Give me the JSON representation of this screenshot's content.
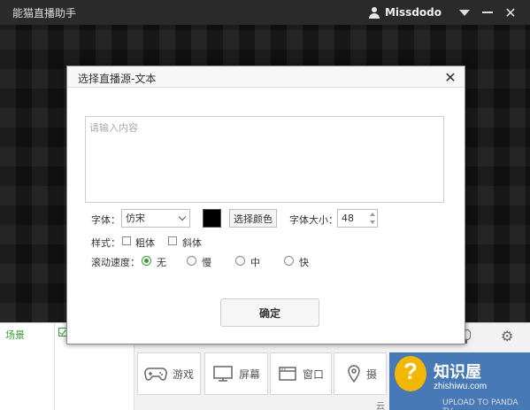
{
  "app": {
    "title": "能猫直播助手",
    "username": "Missdodo"
  },
  "dialog": {
    "title": "选择直播源-文本",
    "content_placeholder": "请输入内容",
    "font_label": "字体：",
    "font_value": "仿宋",
    "pick_color_label": "选择颜色",
    "font_color": "#000000",
    "font_size_label": "字体大小：",
    "font_size_value": "48",
    "style_label": "样式：",
    "bold_label": "粗体",
    "italic_label": "斜体",
    "bold_checked": false,
    "italic_checked": false,
    "speed_label": "滚动速度：",
    "speed_options": [
      "无",
      "慢",
      "中",
      "快"
    ],
    "speed_selected": "无",
    "confirm_label": "确定"
  },
  "bottom": {
    "scene_label": "场景",
    "modes": [
      {
        "label": "游戏",
        "icon": "gamepad-icon"
      },
      {
        "label": "屏幕",
        "icon": "monitor-icon"
      },
      {
        "label": "窗口",
        "icon": "window-icon"
      },
      {
        "label": "摄",
        "icon": "location-icon"
      }
    ],
    "footer_text": "云",
    "footer_text2": "UPLOAD TO PANDA TV"
  },
  "watermark": {
    "title": "知识屋",
    "url": "zhishiwu.com"
  },
  "colors": {
    "accent_green": "#3a9c3a"
  }
}
